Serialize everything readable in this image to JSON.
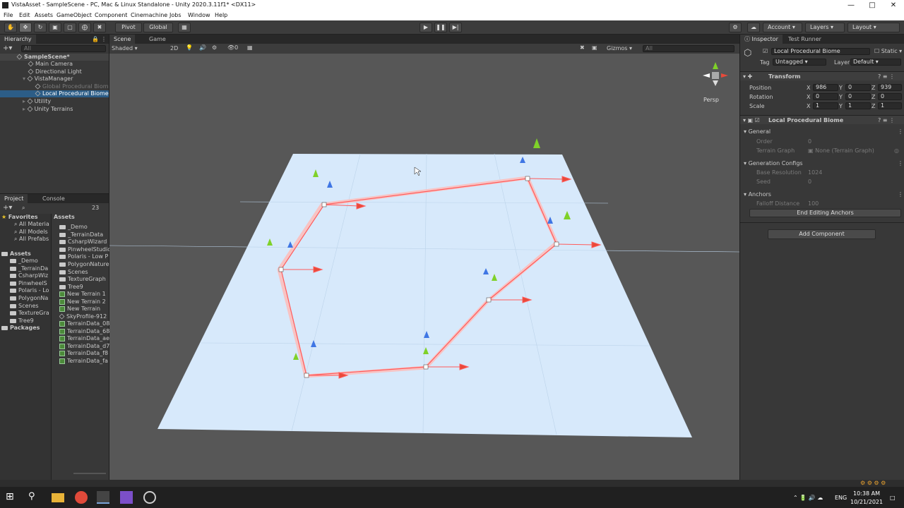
{
  "window": {
    "title": "VistaAsset - SampleScene - PC, Mac & Linux Standalone - Unity 2020.3.11f1* <DX11>"
  },
  "menu": [
    "File",
    "Edit",
    "Assets",
    "GameObject",
    "Component",
    "Cinemachine",
    "Jobs",
    "Window",
    "Help"
  ],
  "toolbar": {
    "pivot": "Pivot",
    "global": "Global",
    "account": "Account",
    "layers": "Layers",
    "layout": "Layout"
  },
  "hierarchy": {
    "tab": "Hierarchy",
    "search_placeholder": "All",
    "scene": "SampleScene*",
    "items": [
      "Main Camera",
      "Directional Light",
      "VistaManager",
      "Global Procedural Biome",
      "Local Procedural Biome",
      "Utility",
      "Unity Terrains"
    ]
  },
  "scene_view": {
    "tabs": [
      "Scene",
      "Game"
    ],
    "shading": "Shaded",
    "mode_2d": "2D",
    "hidden_count": "0",
    "gizmos": "Gizmos",
    "search_placeholder": "All",
    "persp_label": "Persp"
  },
  "project": {
    "tabs": [
      "Project",
      "Console"
    ],
    "hidden_count": "23",
    "favorites_label": "Favorites",
    "favorites": [
      "All Materia",
      "All Models",
      "All Prefabs"
    ],
    "assets_label": "Assets",
    "asset_folders": [
      "_Demo",
      "_TerrainDa",
      "CsharpWiz",
      "PinwheelS",
      "Polaris - Lo",
      "PolygonNa",
      "Scenes",
      "TextureGra",
      "Tree9"
    ],
    "packages_label": "Packages",
    "breadcrumb": "Assets",
    "files": [
      "_Demo",
      "_TerrainData",
      "CsharpWizard",
      "PinwheelStudio",
      "Polaris - Low P",
      "PolygonNature",
      "Scenes",
      "TextureGraph",
      "Tree9",
      "New Terrain 1",
      "New Terrain 2",
      "New Terrain",
      "SkyProfile-912",
      "TerrainData_08",
      "TerrainData_68",
      "TerrainData_ae",
      "TerrainData_d7",
      "TerrainData_f8",
      "TerrainData_fa"
    ]
  },
  "inspector": {
    "tabs": [
      "Inspector",
      "Test Runner"
    ],
    "object_name": "Local Procedural Biome",
    "static_label": "Static",
    "tag_label": "Tag",
    "tag_value": "Untagged",
    "layer_label": "Layer",
    "layer_value": "Default",
    "transform": {
      "title": "Transform",
      "position_label": "Position",
      "rotation_label": "Rotation",
      "scale_label": "Scale",
      "position": [
        "986",
        "0",
        "939"
      ],
      "rotation": [
        "0",
        "0",
        "0"
      ],
      "scale": [
        "1",
        "1",
        "1"
      ],
      "axes": [
        "X",
        "Y",
        "Z"
      ]
    },
    "component": {
      "title": "Local Procedural Biome",
      "general": "General",
      "order_label": "Order",
      "order_value": "0",
      "terrain_graph_label": "Terrain Graph",
      "terrain_graph_value": "None (Terrain Graph)",
      "generation_configs": "Generation Configs",
      "base_res_label": "Base Resolution",
      "base_res_value": "1024",
      "seed_label": "Seed",
      "seed_value": "0",
      "anchors": "Anchors",
      "falloff_label": "Falloff Distance",
      "falloff_value": "100",
      "end_editing": "End Editing Anchors"
    },
    "add_component": "Add Component"
  },
  "taskbar": {
    "lang": "ENG",
    "time": "10:38 AM",
    "date": "10/21/2021"
  },
  "colors": {
    "accent": "#2c5d87",
    "terrain": "#d7e9fb",
    "path": "#ff5b5b"
  }
}
